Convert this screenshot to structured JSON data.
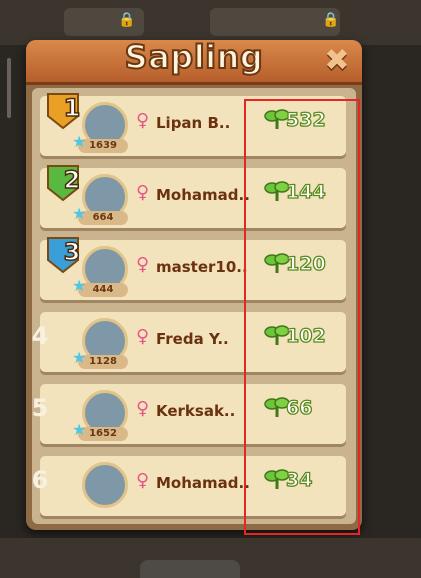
{
  "panel": {
    "title": "Sapling"
  },
  "leaderboard": [
    {
      "rank": "1",
      "name": "Lipan B..",
      "level": "1639",
      "score": "532",
      "rank_color": "#e9a024"
    },
    {
      "rank": "2",
      "name": "Mohamad..",
      "level": "664",
      "score": "144",
      "rank_color": "#58b840"
    },
    {
      "rank": "3",
      "name": "master10..",
      "level": "444",
      "score": "120",
      "rank_color": "#3a9fd6"
    },
    {
      "rank": "4",
      "name": "Freda Y..",
      "level": "1128",
      "score": "102",
      "rank_color": null
    },
    {
      "rank": "5",
      "name": "Kerksak..",
      "level": "1652",
      "score": "66",
      "rank_color": null
    },
    {
      "rank": "6",
      "name": "Mohamad..",
      "level": "",
      "score": "34",
      "rank_color": null
    }
  ],
  "icons": {
    "close": "close-icon",
    "gender": "female-icon",
    "score": "sapling-icon",
    "level": "star-icon"
  },
  "colors": {
    "highlight": "#e62626",
    "header": "#c96f37",
    "row": "#f3e3bd"
  }
}
